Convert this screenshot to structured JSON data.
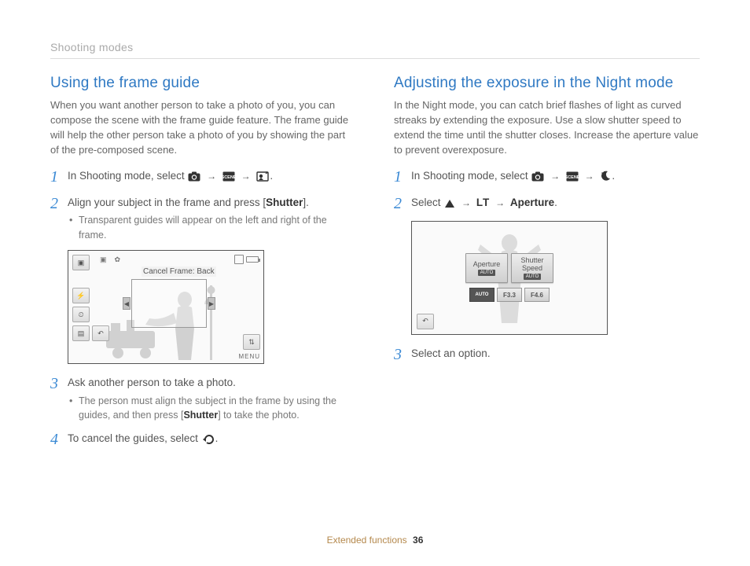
{
  "breadcrumb": "Shooting modes",
  "footer": {
    "section": "Extended functions",
    "page": "36"
  },
  "left": {
    "title": "Using the frame guide",
    "intro": "When you want another person to take a photo of you, you can compose the scene with the frame guide feature. The frame guide will help the other person take a photo of you by showing the part of the pre-composed scene.",
    "step1_pre": "In Shooting mode, select ",
    "step2_main": "Align your subject in the frame and press [",
    "step2_shutter": "Shutter",
    "step2_post": "].",
    "step2_bullet": "Transparent guides will appear on the left and right of the frame.",
    "shot_label": "Cancel Frame: Back",
    "shot_menu": "MENU",
    "step3_main": "Ask another person to take a photo.",
    "step3_bullet_a": "The person must align the subject in the frame by using the guides, and then press [",
    "step3_bullet_shutter": "Shutter",
    "step3_bullet_b": "] to take the photo.",
    "step4": "To cancel the guides, select "
  },
  "right": {
    "title": "Adjusting the exposure in the Night mode",
    "intro": "In the Night mode, you can catch brief flashes of light as curved streaks by extending the exposure. Use a slow shutter speed to extend the time until the shutter closes. Increase the aperture value to prevent overexposure.",
    "step1_pre": "In Shooting mode, select ",
    "step2_pre": "Select ",
    "step2_lt": "LT",
    "step2_post": " Aperture",
    "shot_btn_aperture": "Aperture",
    "shot_btn_shutter_a": "Shutter",
    "shot_btn_shutter_b": "Speed",
    "shot_auto": "AUTO",
    "shot_f33": "F3.3",
    "shot_f46": "F4.6",
    "step3": "Select an option."
  }
}
